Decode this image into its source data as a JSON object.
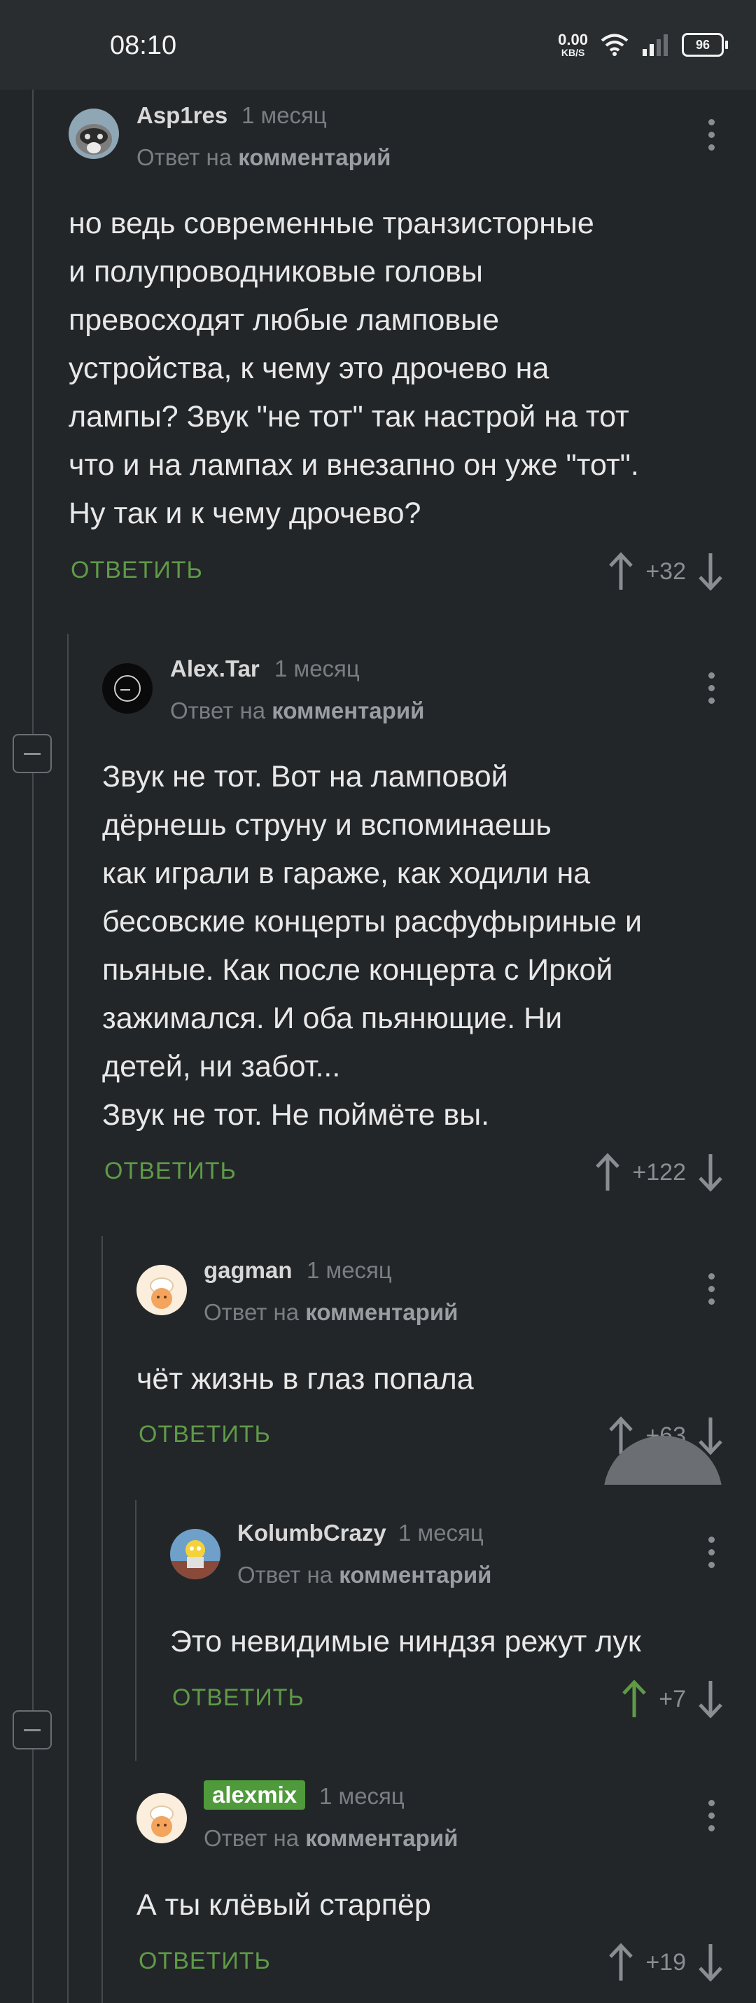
{
  "status_bar": {
    "time": "08:10",
    "net_speed_value": "0.00",
    "net_speed_unit": "KB/S",
    "battery": "96"
  },
  "comments": [
    {
      "username": "Asp1res",
      "time": "1 месяц",
      "reply_prefix": "Ответ на",
      "reply_target": "комментарий",
      "body": "но ведь современные транзисторные\nи полупроводниковые головы\nпревосходят любые ламповые\nустройства, к чему это дрочево на\nлампы? Звук \"не тот\" так настрой на тот\nчто и на лампах и внезапно он уже \"тот\".\nНу так и к чему дрочево?",
      "reply_label": "ОТВЕТИТЬ",
      "score": "+32"
    },
    {
      "username": "Alex.Tar",
      "time": "1 месяц",
      "reply_prefix": "Ответ на",
      "reply_target": "комментарий",
      "body": "Звук не тот. Вот на ламповой\nдёрнешь струну и вспоминаешь\nкак играли в гараже, как ходили на\nбесовские концерты расфуфыриные и\nпьяные. Как после концерта с Иркой\nзажимался. И оба пьянющие. Ни\nдетей, ни забот...\nЗвук не тот. Не поймёте вы.",
      "reply_label": "ОТВЕТИТЬ",
      "score": "+122"
    },
    {
      "username": "gagman",
      "time": "1 месяц",
      "reply_prefix": "Ответ на",
      "reply_target": "комментарий",
      "body": "чёт жизнь в глаз попала",
      "reply_label": "ОТВЕТИТЬ",
      "score": "+63"
    },
    {
      "username": "KolumbCrazy",
      "time": "1 месяц",
      "reply_prefix": "Ответ на",
      "reply_target": "комментарий",
      "body": "Это невидимые ниндзя режут лук",
      "reply_label": "ОТВЕТИТЬ",
      "score": "+7"
    },
    {
      "username": "alexmix",
      "time": "1 месяц",
      "reply_prefix": "Ответ на",
      "reply_target": "комментарий",
      "body": "А ты клёвый старпёр",
      "reply_label": "ОТВЕТИТЬ",
      "score": "+19"
    }
  ],
  "colors": {
    "background": "#232629",
    "reply_green": "#5f9a47",
    "upvote_active": "#5f9a47",
    "badge_green": "#4f9a3a"
  },
  "icons": [
    "wifi-icon",
    "signal-icon",
    "battery-icon",
    "kebab-menu-icon",
    "upvote-icon",
    "downvote-icon",
    "collapse-icon",
    "compose-fab-icon"
  ]
}
